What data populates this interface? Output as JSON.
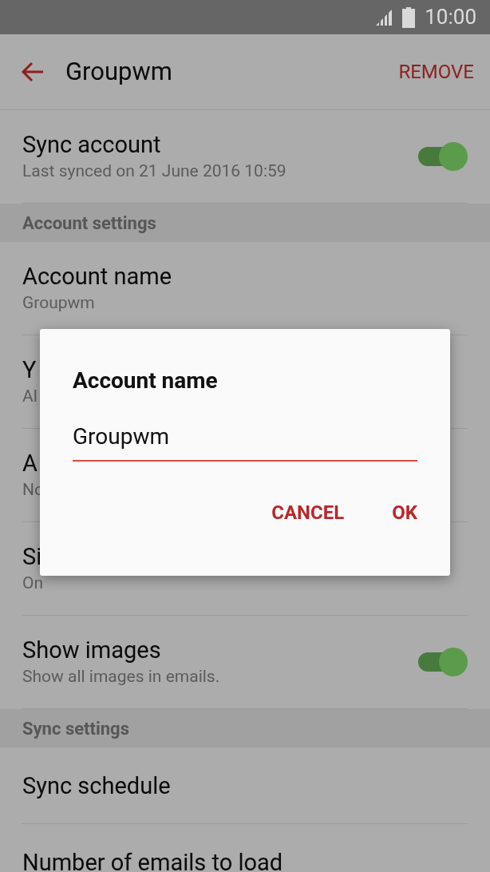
{
  "status_bar": {
    "time": "10:00"
  },
  "app_bar": {
    "title": "Groupwm",
    "action": "REMOVE"
  },
  "items": [
    {
      "kind": "toggle",
      "title": "Sync account",
      "subtitle": "Last synced on 21 June 2016  10:59",
      "on": true
    },
    {
      "kind": "header",
      "title": "Account settings"
    },
    {
      "kind": "text",
      "title": "Account name",
      "subtitle": "Groupwm"
    },
    {
      "kind": "text",
      "title": "Y",
      "subtitle": "Al"
    },
    {
      "kind": "text",
      "title": "A",
      "subtitle": "No"
    },
    {
      "kind": "text",
      "title": "Si",
      "subtitle": "On"
    },
    {
      "kind": "toggle",
      "title": "Show images",
      "subtitle": "Show all images in emails.",
      "on": true
    },
    {
      "kind": "header",
      "title": "Sync settings"
    },
    {
      "kind": "text",
      "title": "Sync schedule"
    },
    {
      "kind": "text",
      "title": "Number of emails to load"
    }
  ],
  "dialog": {
    "title": "Account name",
    "value": "Groupwm",
    "buttons": [
      "CANCEL",
      "OK"
    ]
  }
}
